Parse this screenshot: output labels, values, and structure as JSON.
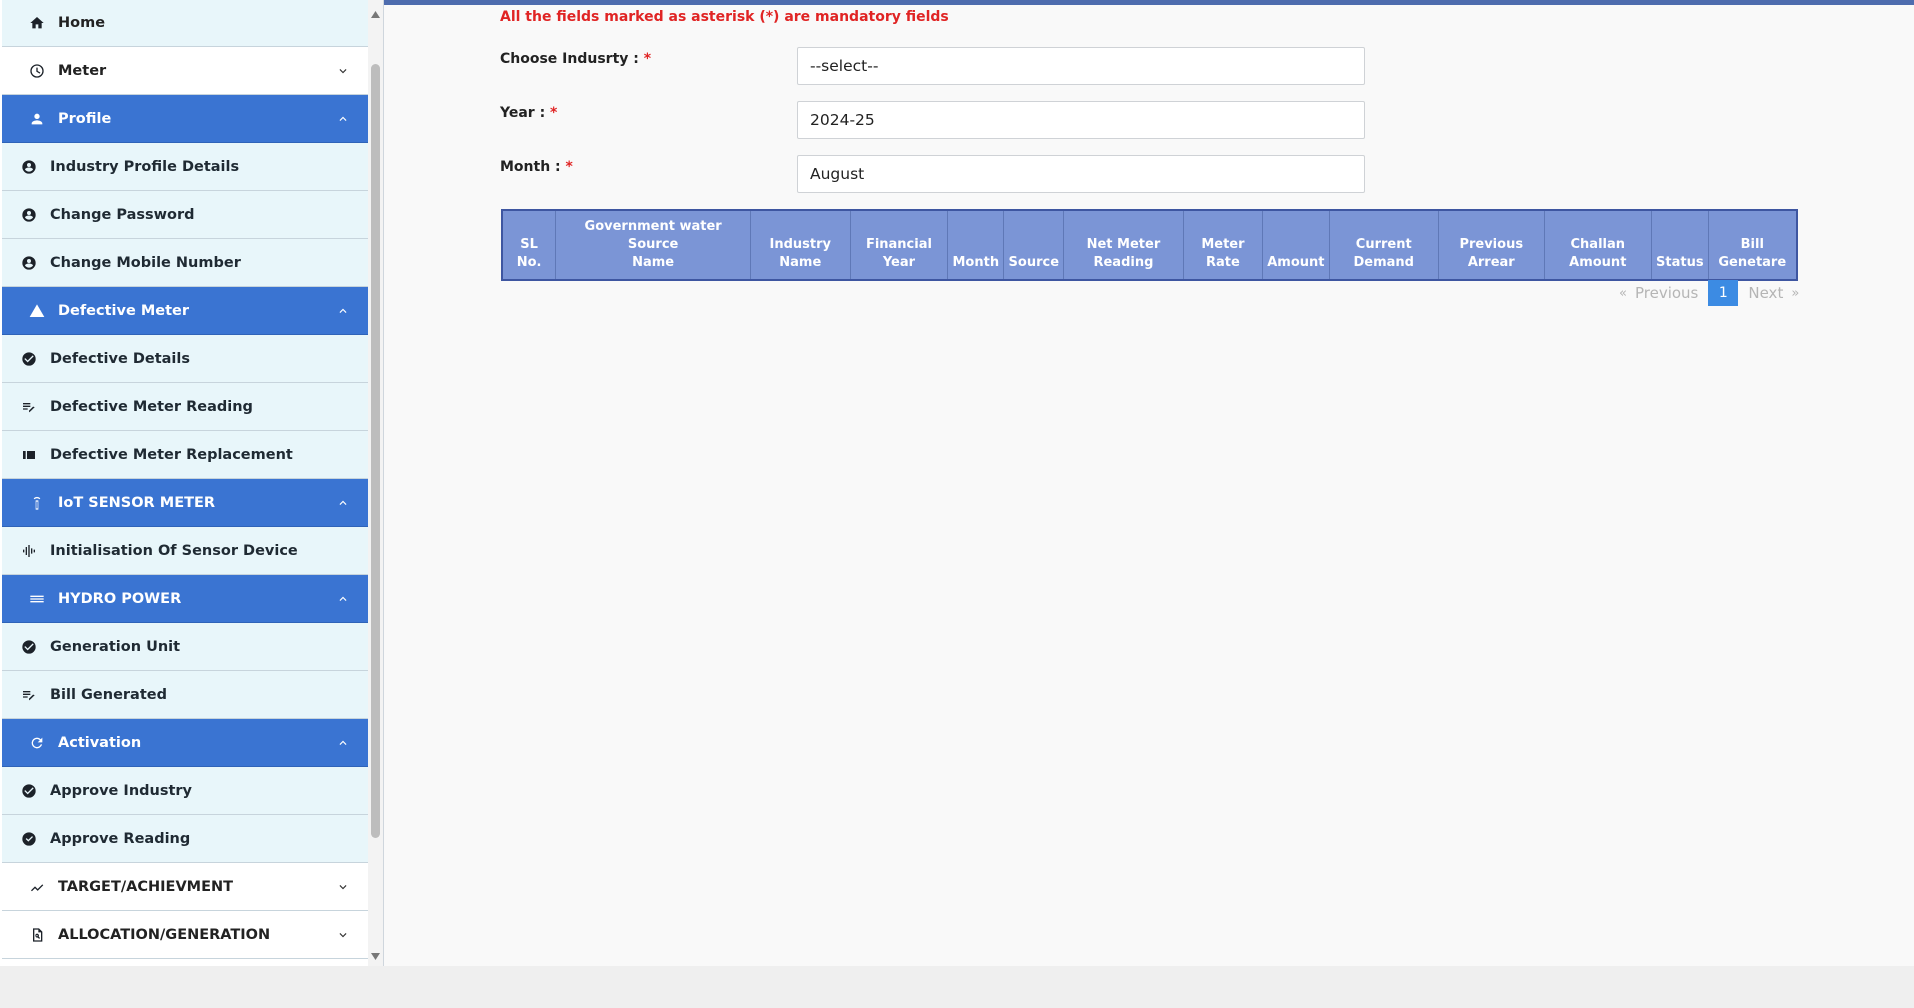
{
  "sidebar": {
    "home": "Home",
    "meter": "Meter",
    "profile": {
      "label": "Profile",
      "items": [
        "Industry Profile Details",
        "Change Password",
        "Change Mobile Number"
      ]
    },
    "defective": {
      "label": "Defective Meter",
      "items": [
        "Defective Details",
        "Defective Meter Reading",
        "Defective Meter Replacement"
      ]
    },
    "iot": {
      "label": "IoT SENSOR METER",
      "items": [
        "Initialisation Of Sensor Device"
      ]
    },
    "hydro": {
      "label": "HYDRO POWER",
      "items": [
        "Generation Unit",
        "Bill Generated"
      ]
    },
    "activation": {
      "label": "Activation",
      "items": [
        "Approve Industry",
        "Approve Reading"
      ]
    },
    "target": "TARGET/ACHIEVMENT",
    "allocation": "ALLOCATION/GENERATION"
  },
  "form": {
    "note": "All the fields marked as asterisk (*) are mandatory fields",
    "industry_label": "Choose Indusrty :",
    "industry_value": "--select--",
    "year_label": "Year :",
    "year_value": "2024-25",
    "month_label": "Month :",
    "month_value": "August",
    "required_mark": "*"
  },
  "table": {
    "headers": [
      [
        "SL",
        "No."
      ],
      [
        "Government water Source",
        "Name"
      ],
      [
        "Industry",
        "Name"
      ],
      [
        "Financial",
        "Year"
      ],
      [
        "Month"
      ],
      [
        "Source"
      ],
      [
        "Net Meter",
        "Reading"
      ],
      [
        "Meter",
        "Rate"
      ],
      [
        "Amount"
      ],
      [
        "Current",
        "Demand"
      ],
      [
        "Previous",
        "Arrear"
      ],
      [
        "Challan",
        "Amount"
      ],
      [
        "Status"
      ],
      [
        "Bill",
        "Genetare"
      ]
    ]
  },
  "pagination": {
    "prev_arrow": "«",
    "previous": "Previous",
    "current": "1",
    "next": "Next",
    "next_arrow": "»"
  }
}
